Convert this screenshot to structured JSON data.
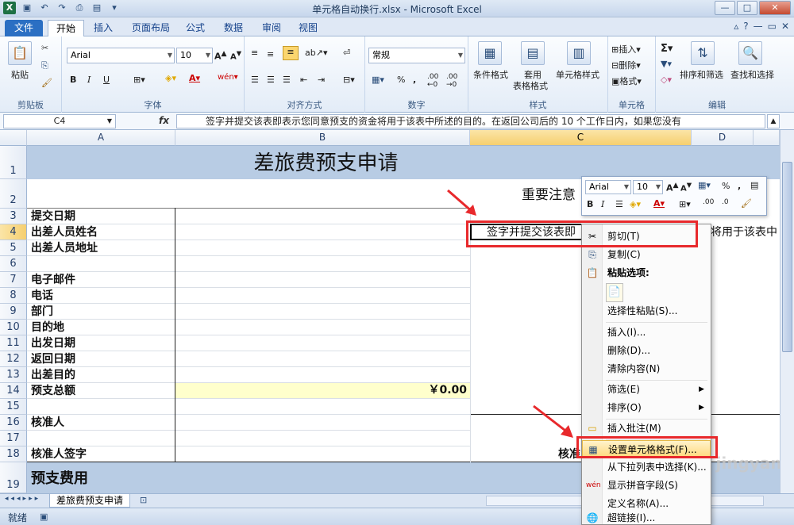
{
  "window": {
    "title": "单元格自动换行.xlsx - Microsoft Excel"
  },
  "ribbon_tabs": [
    "文件",
    "开始",
    "插入",
    "页面布局",
    "公式",
    "数据",
    "审阅",
    "视图"
  ],
  "ribbon": {
    "clipboard": {
      "paste": "粘贴",
      "label": "剪贴板"
    },
    "font": {
      "name": "Arial",
      "size": "10",
      "label": "字体"
    },
    "alignment": {
      "label": "对齐方式"
    },
    "number": {
      "format": "常规",
      "label": "数字"
    },
    "styles": {
      "conditional": "条件格式",
      "table": "套用",
      "table2": "表格格式",
      "cell": "单元格样式",
      "label": "样式"
    },
    "cells": {
      "insert": "插入",
      "delete": "删除",
      "format": "格式",
      "label": "单元格"
    },
    "editing": {
      "sort": "排序和筛选",
      "find": "查找和选择",
      "label": "编辑"
    }
  },
  "formula_bar": {
    "name_box": "C4",
    "fx": "fx",
    "content": "签字并提交该表即表示您同意预支的资金将用于该表中所述的目的。在返回公司后的 10 个工作日内，如果您没有"
  },
  "columns": [
    "A",
    "B",
    "C",
    "D"
  ],
  "rows": [
    {
      "num": "1",
      "a": ""
    },
    {
      "num": "2",
      "a": ""
    },
    {
      "num": "3",
      "a": "提交日期"
    },
    {
      "num": "4",
      "a": "出差人员姓名"
    },
    {
      "num": "5",
      "a": "出差人员地址"
    },
    {
      "num": "6",
      "a": ""
    },
    {
      "num": "7",
      "a": "电子邮件"
    },
    {
      "num": "8",
      "a": "电话"
    },
    {
      "num": "9",
      "a": "部门"
    },
    {
      "num": "10",
      "a": "目的地"
    },
    {
      "num": "11",
      "a": "出发日期"
    },
    {
      "num": "12",
      "a": "返回日期"
    },
    {
      "num": "13",
      "a": "出差目的"
    },
    {
      "num": "14",
      "a": "预支总额"
    },
    {
      "num": "15",
      "a": ""
    },
    {
      "num": "16",
      "a": "核准人"
    },
    {
      "num": "17",
      "a": ""
    },
    {
      "num": "18",
      "a": "核准人签字"
    },
    {
      "num": "19",
      "a": "预支费用"
    }
  ],
  "cells": {
    "title": "差旅费预支申请",
    "notice": "重要注意",
    "c4": "签字并提交该表即",
    "d4": "将用于该表中",
    "b14": "￥0.00",
    "c18": "核准"
  },
  "mini_toolbar": {
    "font": "Arial",
    "size": "10"
  },
  "context_menu": {
    "cut": "剪切(T)",
    "copy": "复制(C)",
    "paste_options": "粘贴选项:",
    "paste_special": "选择性粘贴(S)...",
    "insert": "插入(I)...",
    "delete": "删除(D)...",
    "clear": "清除内容(N)",
    "filter": "筛选(E)",
    "sort": "排序(O)",
    "comment": "插入批注(M)",
    "format_cells": "设置单元格格式(F)...",
    "pick_list": "从下拉列表中选择(K)...",
    "phonetic": "显示拼音字段(S)",
    "define_name": "定义名称(A)...",
    "hyperlink": "超链接(I)..."
  },
  "sheet": {
    "tab": "差旅费预支申请"
  },
  "status": {
    "ready": "就绪"
  },
  "watermark": "Bai 经验 jingyan.baidu.com",
  "colors": {
    "header_fill": "#b8cce4",
    "yellow_fill": "#ffffcc",
    "highlight_red": "#e8292c"
  }
}
